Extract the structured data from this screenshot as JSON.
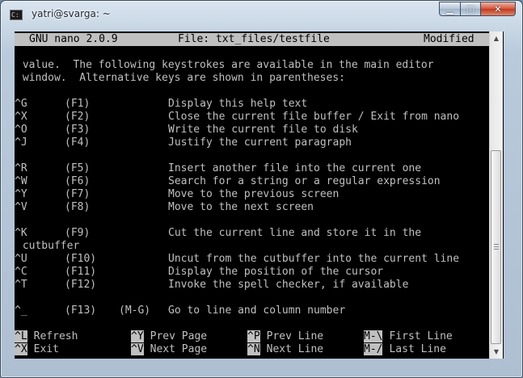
{
  "window": {
    "title": "yatri@svarga: ~",
    "buttons": {
      "minimize": "▁",
      "maximize": "□",
      "close": "✕"
    }
  },
  "nano": {
    "version": "GNU nano 2.0.9",
    "file": "File: txt_files/testfile",
    "status": "Modified"
  },
  "help": {
    "intro": [
      " value.  The following keystrokes are available in the main editor",
      " window.  Alternative keys are shown in parentheses:"
    ],
    "rows": [
      {
        "key": "^G",
        "fkey": "(F1)",
        "alt": "",
        "desc": "Display this help text"
      },
      {
        "key": "^X",
        "fkey": "(F2)",
        "alt": "",
        "desc": "Close the current file buffer / Exit from nano"
      },
      {
        "key": "^O",
        "fkey": "(F3)",
        "alt": "",
        "desc": "Write the current file to disk"
      },
      {
        "key": "^J",
        "fkey": "(F4)",
        "alt": "",
        "desc": "Justify the current paragraph"
      },
      {
        "key": "^R",
        "fkey": "(F5)",
        "alt": "",
        "desc": "Insert another file into the current one"
      },
      {
        "key": "^W",
        "fkey": "(F6)",
        "alt": "",
        "desc": "Search for a string or a regular expression"
      },
      {
        "key": "^Y",
        "fkey": "(F7)",
        "alt": "",
        "desc": "Move to the previous screen"
      },
      {
        "key": "^V",
        "fkey": "(F8)",
        "alt": "",
        "desc": "Move to the next screen"
      },
      {
        "key": "^K",
        "fkey": "(F9)",
        "alt": "",
        "desc": "Cut the current line and store it in the"
      },
      {
        "key": "^U",
        "fkey": "(F10)",
        "alt": "",
        "desc": "Uncut from the cutbuffer into the current line"
      },
      {
        "key": "^C",
        "fkey": "(F11)",
        "alt": "",
        "desc": "Display the position of the cursor"
      },
      {
        "key": "^T",
        "fkey": "(F12)",
        "alt": "",
        "desc": "Invoke the spell checker, if available"
      },
      {
        "key": "^_",
        "fkey": "(F13)",
        "alt": "(M-G)",
        "desc": "Go to line and column number"
      }
    ],
    "wrap": " cutbuffer"
  },
  "shortcuts": [
    {
      "key": "^L",
      "label": "Refresh"
    },
    {
      "key": "^Y",
      "label": "Prev Page"
    },
    {
      "key": "^P",
      "label": "Prev Line"
    },
    {
      "key": "M-\\",
      "label": "First Line"
    },
    {
      "key": "^X",
      "label": "Exit"
    },
    {
      "key": "^V",
      "label": "Next Page"
    },
    {
      "key": "^N",
      "label": "Next Line"
    },
    {
      "key": "M-/",
      "label": "Last Line"
    }
  ],
  "colors": {
    "terminal_bg": "#000000",
    "terminal_fg": "#c0c0c0",
    "highlight_bg": "#c0c0c0"
  }
}
